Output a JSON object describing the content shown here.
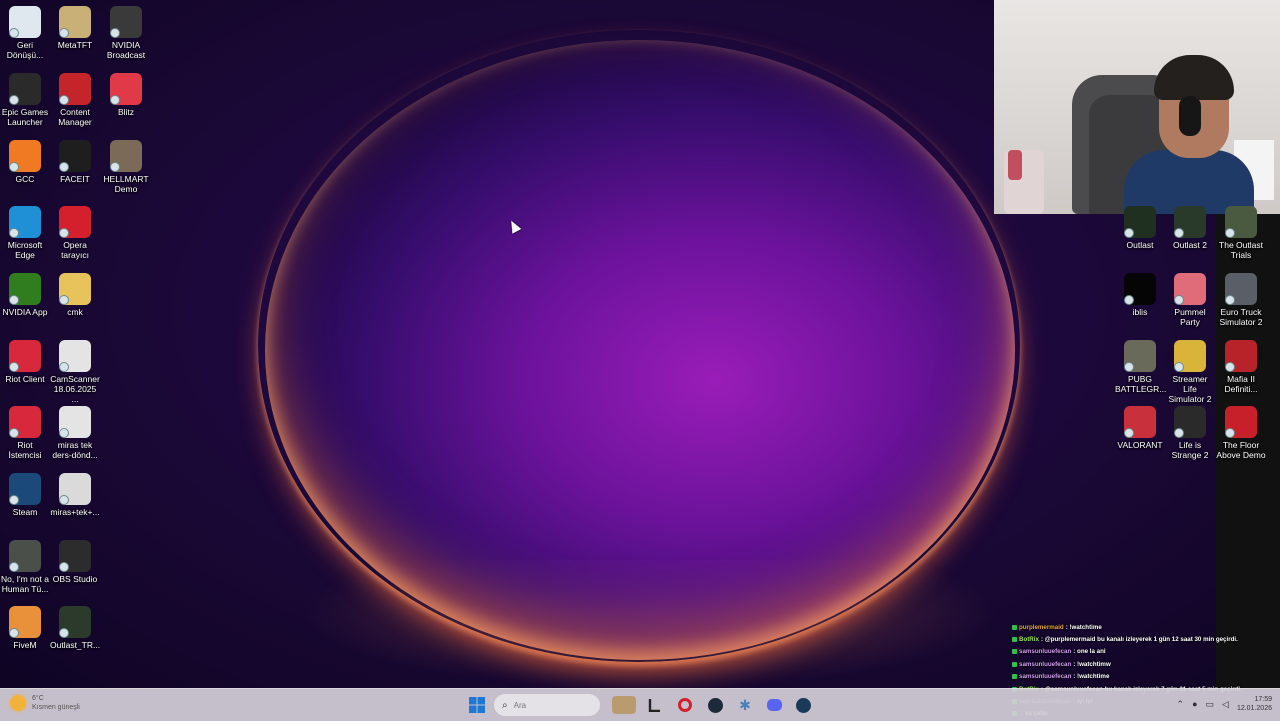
{
  "desktop": {
    "left_icons": [
      {
        "label": "Geri\nDönüşü...",
        "icon": "recycle-bin-icon",
        "color": "#dfe8ee"
      },
      {
        "label": "MetaTFT",
        "icon": "metatft-icon",
        "color": "#c9b077"
      },
      {
        "label": "NVIDIA\nBroadcast",
        "icon": "nvidia-broadcast-icon",
        "color": "#3a3a3a"
      },
      {
        "label": "Epic Games\nLauncher",
        "icon": "epic-games-icon",
        "color": "#2a2a2a"
      },
      {
        "label": "Content\nManager",
        "icon": "content-manager-icon",
        "color": "#c4252b"
      },
      {
        "label": "Blitz",
        "icon": "blitz-icon",
        "color": "#e03a48"
      },
      {
        "label": "GCC",
        "icon": "gcc-icon",
        "color": "#f07a24"
      },
      {
        "label": "FACEIT",
        "icon": "faceit-icon",
        "color": "#1e1e1e"
      },
      {
        "label": "HELLMART\nDemo",
        "icon": "hellmart-icon",
        "color": "#7b6a58"
      },
      {
        "label": "Microsoft\nEdge",
        "icon": "edge-icon",
        "color": "#1f8fd6"
      },
      {
        "label": "Opera\ntarayıcı",
        "icon": "opera-icon",
        "color": "#d3202c"
      },
      {
        "label": "NVIDIA App",
        "icon": "nvidia-app-icon",
        "color": "#2f7d1e"
      },
      {
        "label": "cmk",
        "icon": "folder-icon",
        "color": "#e8c25a"
      },
      {
        "label": "Riot Client",
        "icon": "riot-client-icon",
        "color": "#d8283b"
      },
      {
        "label": "CamScanner\n18.06.2025 ...",
        "icon": "document-icon",
        "color": "#e4e4e4"
      },
      {
        "label": "Riot İstemcisi",
        "icon": "riot-client-icon",
        "color": "#d8283b"
      },
      {
        "label": "miras tek\nders-dönd...",
        "icon": "document-icon",
        "color": "#e4e4e4"
      },
      {
        "label": "Steam",
        "icon": "steam-icon",
        "color": "#1b4a7a"
      },
      {
        "label": "miras+tek+...",
        "icon": "document-icon",
        "color": "#dadada"
      },
      {
        "label": "No, I'm not a\nHuman Tü...",
        "icon": "game-icon",
        "color": "#4b4f4a"
      },
      {
        "label": "OBS Studio",
        "icon": "obs-icon",
        "color": "#2c2c2c"
      },
      {
        "label": "FiveM",
        "icon": "fivem-icon",
        "color": "#e8903a"
      },
      {
        "label": "Outlast_TR...",
        "icon": "outlast-tr-icon",
        "color": "#2b3a2b"
      }
    ],
    "right_icons": [
      {
        "label": "Outlast",
        "icon": "outlast-icon",
        "color": "#203020"
      },
      {
        "label": "Outlast 2",
        "icon": "outlast2-icon",
        "color": "#2a3a2a"
      },
      {
        "label": "The Outlast\nTrials",
        "icon": "outlast-trials-icon",
        "color": "#4a5a40"
      },
      {
        "label": "iblis",
        "icon": "iblis-icon",
        "color": "#050505"
      },
      {
        "label": "Pummel\nParty",
        "icon": "pummel-party-icon",
        "color": "#e06c7a"
      },
      {
        "label": "Euro Truck\nSimulator 2",
        "icon": "euro-truck-icon",
        "color": "#5a5e66"
      },
      {
        "label": "PUBG\nBATTLEGR...",
        "icon": "pubg-icon",
        "color": "#6a6a5a"
      },
      {
        "label": "Streamer Life\nSimulator 2",
        "icon": "streamer-life-icon",
        "color": "#d8b43a"
      },
      {
        "label": "Mafia II\nDefiniti...",
        "icon": "mafia2-icon",
        "color": "#b8232a"
      },
      {
        "label": "VALORANT",
        "icon": "valorant-icon",
        "color": "#c8303c"
      },
      {
        "label": "Life is\nStrange 2",
        "icon": "life-is-strange-icon",
        "color": "#2a2a2a"
      },
      {
        "label": "The Floor\nAbove Demo",
        "icon": "floor-above-icon",
        "color": "#c8202a"
      }
    ]
  },
  "chat": [
    {
      "user": "purplemermaid",
      "user_color": "#e8a23a",
      "msg": ": !watchtime"
    },
    {
      "user": "BotRix",
      "user_color": "#9be84a",
      "msg": ": @purplemermaid bu kanalı izleyerek 1 gün 12 saat 30 min geçirdi."
    },
    {
      "user": "samsunluuefecan",
      "user_color": "#d39cf0",
      "msg": ": one la ani"
    },
    {
      "user": "samsunluuefecan",
      "user_color": "#d39cf0",
      "msg": ": !watchtimw"
    },
    {
      "user": "samsunluuefecan",
      "user_color": "#d39cf0",
      "msg": ": !watchtime"
    },
    {
      "user": "BotRix",
      "user_color": "#9be84a",
      "msg": ": @samsunluuefecan bu kanalı izleyerek 7 gün 21 saat 5 min geçirdi."
    },
    {
      "user": "samsunluuefecan",
      "user_color": "#d39cf0",
      "msg": ": iyi iyi"
    },
    {
      "user": "",
      "user_color": "#d39cf0",
      "msg": ": sa çetin"
    }
  ],
  "taskbar": {
    "weather_temp": "6°C",
    "weather_desc": "Kısmen güneşli",
    "search_placeholder": "Ara",
    "clock_time": "17:59",
    "clock_date": "12.01.2026"
  },
  "colors": {
    "accent": "#a020c0",
    "taskbar": "#d2ced6"
  }
}
